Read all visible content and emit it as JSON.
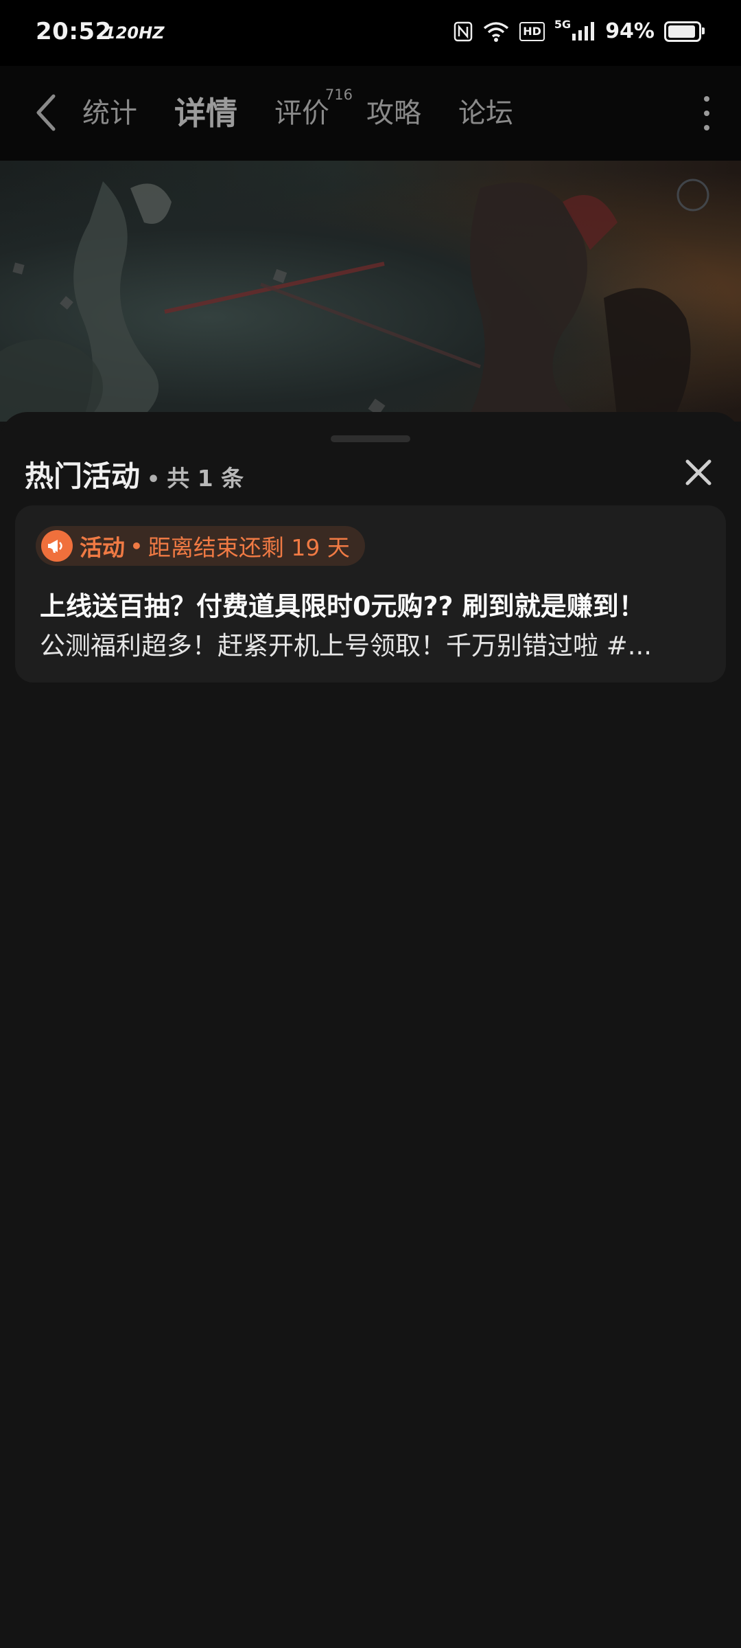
{
  "status_bar": {
    "time": "20:52",
    "refresh_rate": "120HZ",
    "battery_percent": "94%",
    "battery_level": 0.94,
    "hd_label": "HD",
    "network_label": "5G"
  },
  "nav": {
    "tabs": [
      {
        "label": "统计"
      },
      {
        "label": "详情",
        "active": true
      },
      {
        "label": "评价",
        "badge": "716"
      },
      {
        "label": "攻略"
      },
      {
        "label": "论坛"
      }
    ],
    "accent_color": "#0f6c5f"
  },
  "sheet": {
    "title": "热门活动",
    "separator": "•",
    "count_text": "共 1 条"
  },
  "activity": {
    "tag_label": "活动",
    "tag_separator": "•",
    "remaining_text": "距离结束还剩 19 天",
    "title": "上线送百抽？付费道具限时0元购??  刷到就是赚到！",
    "description": "公测福利超多！赶紧开机上号领取！千万别错过啦 #...",
    "accent_color": "#f0703c"
  },
  "icons": {
    "back": "back-arrow-icon",
    "more": "more-vertical-icon",
    "close": "close-icon",
    "activity": "megaphone-icon"
  }
}
